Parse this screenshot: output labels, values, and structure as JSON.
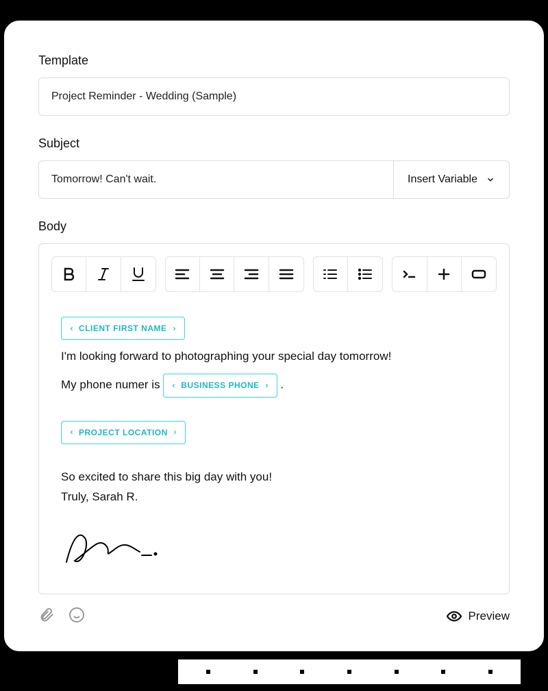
{
  "template": {
    "label": "Template",
    "value": "Project Reminder - Wedding (Sample)"
  },
  "subject": {
    "label": "Subject",
    "value": "Tomorrow! Can't wait.",
    "insert_variable_label": "Insert Variable"
  },
  "body": {
    "label": "Body",
    "content": {
      "var_client_first_name": "CLIENT FIRST NAME",
      "line1": "I'm looking forward to photographing your special day tomorrow!",
      "line2_prefix": "My phone numer is ",
      "var_business_phone": "BUSINESS PHONE",
      "line2_suffix": " .",
      "var_project_location": "PROJECT LOCATION",
      "line3": "So excited to share this big day with you!",
      "line4": "Truly, Sarah R."
    }
  },
  "footer": {
    "preview_label": "Preview"
  }
}
